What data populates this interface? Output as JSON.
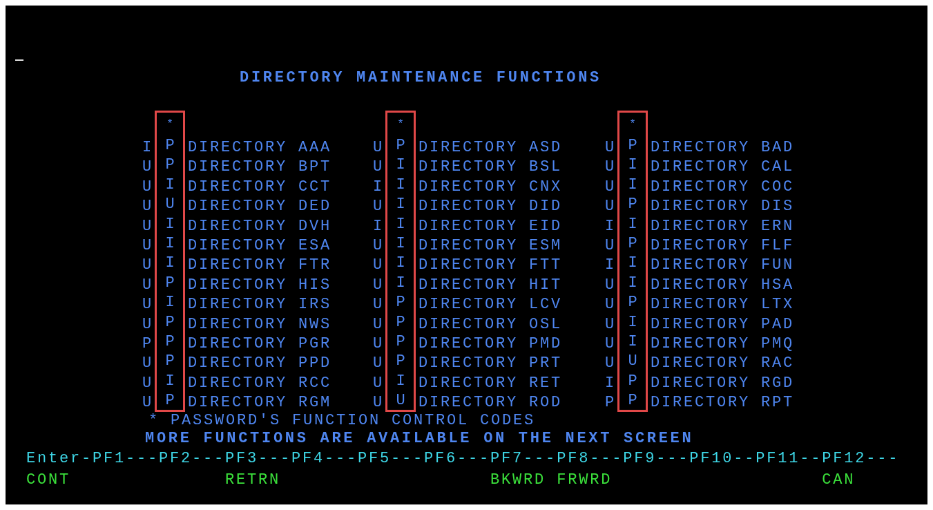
{
  "title": "DIRECTORY MAINTENANCE FUNCTIONS",
  "columns": [
    {
      "marker": "*",
      "rows": [
        {
          "flag": "I",
          "code": "P",
          "name": "DIRECTORY AAA"
        },
        {
          "flag": "U",
          "code": "P",
          "name": "DIRECTORY BPT"
        },
        {
          "flag": "U",
          "code": "I",
          "name": "DIRECTORY CCT"
        },
        {
          "flag": "U",
          "code": "U",
          "name": "DIRECTORY DED"
        },
        {
          "flag": "U",
          "code": "I",
          "name": "DIRECTORY DVH"
        },
        {
          "flag": "U",
          "code": "I",
          "name": "DIRECTORY ESA"
        },
        {
          "flag": "U",
          "code": "I",
          "name": "DIRECTORY FTR"
        },
        {
          "flag": "U",
          "code": "P",
          "name": "DIRECTORY HIS"
        },
        {
          "flag": "U",
          "code": "I",
          "name": "DIRECTORY IRS"
        },
        {
          "flag": "U",
          "code": "P",
          "name": "DIRECTORY NWS"
        },
        {
          "flag": "P",
          "code": "P",
          "name": "DIRECTORY PGR"
        },
        {
          "flag": "U",
          "code": "P",
          "name": "DIRECTORY PPD"
        },
        {
          "flag": "U",
          "code": "I",
          "name": "DIRECTORY RCC"
        },
        {
          "flag": "U",
          "code": "P",
          "name": "DIRECTORY RGM"
        }
      ]
    },
    {
      "marker": "*",
      "rows": [
        {
          "flag": "U",
          "code": "P",
          "name": "DIRECTORY ASD"
        },
        {
          "flag": "U",
          "code": "I",
          "name": "DIRECTORY BSL"
        },
        {
          "flag": "I",
          "code": "I",
          "name": "DIRECTORY CNX"
        },
        {
          "flag": "U",
          "code": "I",
          "name": "DIRECTORY DID"
        },
        {
          "flag": "I",
          "code": "I",
          "name": "DIRECTORY EID"
        },
        {
          "flag": "U",
          "code": "I",
          "name": "DIRECTORY ESM"
        },
        {
          "flag": "U",
          "code": "I",
          "name": "DIRECTORY FTT"
        },
        {
          "flag": "U",
          "code": "I",
          "name": "DIRECTORY HIT"
        },
        {
          "flag": "U",
          "code": "P",
          "name": "DIRECTORY LCV"
        },
        {
          "flag": "U",
          "code": "P",
          "name": "DIRECTORY OSL"
        },
        {
          "flag": "U",
          "code": "P",
          "name": "DIRECTORY PMD"
        },
        {
          "flag": "U",
          "code": "P",
          "name": "DIRECTORY PRT"
        },
        {
          "flag": "U",
          "code": "I",
          "name": "DIRECTORY RET"
        },
        {
          "flag": "U",
          "code": "U",
          "name": "DIRECTORY ROD"
        }
      ]
    },
    {
      "marker": "*",
      "rows": [
        {
          "flag": "U",
          "code": "P",
          "name": "DIRECTORY BAD"
        },
        {
          "flag": "U",
          "code": "I",
          "name": "DIRECTORY CAL"
        },
        {
          "flag": "U",
          "code": "I",
          "name": "DIRECTORY COC"
        },
        {
          "flag": "U",
          "code": "P",
          "name": "DIRECTORY DIS"
        },
        {
          "flag": "I",
          "code": "I",
          "name": "DIRECTORY ERN"
        },
        {
          "flag": "U",
          "code": "P",
          "name": "DIRECTORY FLF"
        },
        {
          "flag": "I",
          "code": "I",
          "name": "DIRECTORY FUN"
        },
        {
          "flag": "U",
          "code": "I",
          "name": "DIRECTORY HSA"
        },
        {
          "flag": "U",
          "code": "P",
          "name": "DIRECTORY LTX"
        },
        {
          "flag": "U",
          "code": "I",
          "name": "DIRECTORY PAD"
        },
        {
          "flag": "U",
          "code": "I",
          "name": "DIRECTORY PMQ"
        },
        {
          "flag": "U",
          "code": "U",
          "name": "DIRECTORY RAC"
        },
        {
          "flag": "I",
          "code": "P",
          "name": "DIRECTORY RGD"
        },
        {
          "flag": "P",
          "code": "P",
          "name": "DIRECTORY RPT"
        }
      ]
    }
  ],
  "footnote": "* PASSWORD'S FUNCTION CONTROL CODES",
  "notice": "MORE FUNCTIONS ARE AVAILABLE ON THE NEXT SCREEN",
  "function_keys": [
    {
      "key": "Enter-",
      "action": "CONT"
    },
    {
      "key": "PF1---"
    },
    {
      "key": "PF2---"
    },
    {
      "key": "PF3---",
      "action": "RETRN"
    },
    {
      "key": "PF4---"
    },
    {
      "key": "PF5---"
    },
    {
      "key": "PF6---"
    },
    {
      "key": "PF7---",
      "action": "BKWRD"
    },
    {
      "key": "PF8---",
      "action": "FRWRD"
    },
    {
      "key": "PF9---"
    },
    {
      "key": "PF10--"
    },
    {
      "key": "PF11--"
    },
    {
      "key": "PF12---",
      "action": "CAN"
    }
  ]
}
